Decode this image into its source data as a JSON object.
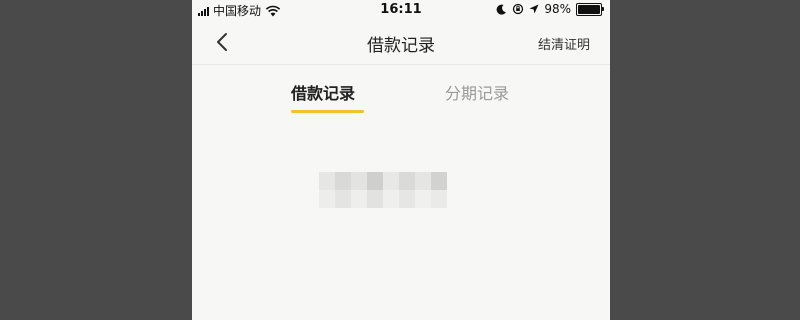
{
  "status_bar": {
    "carrier": "中国移动",
    "time": "16:11",
    "battery": "98%",
    "battery_level": 0.98
  },
  "nav": {
    "title": "借款记录",
    "action": "结清证明",
    "back_icon": "chevron-left-icon"
  },
  "tabs": [
    {
      "label": "借款记录",
      "active": true
    },
    {
      "label": "分期记录",
      "active": false
    }
  ],
  "colors": {
    "accent": "#f2c12e",
    "background": "#f7f8f5",
    "frame": "#4a4a4a"
  }
}
